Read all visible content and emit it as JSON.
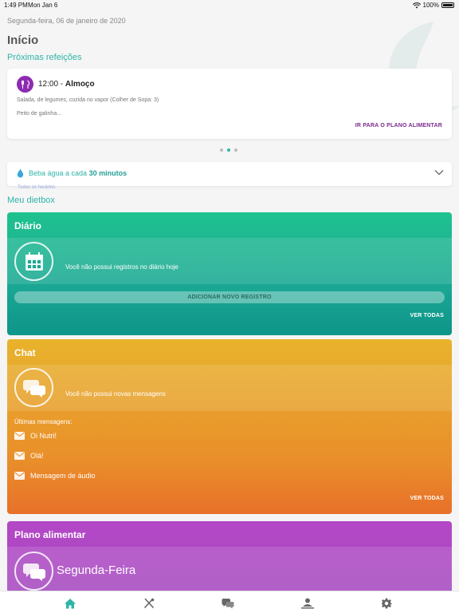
{
  "status_bar": {
    "time": "1:49 PM",
    "date": "Mon Jan 6",
    "battery": "100%"
  },
  "header": {
    "date": "Segunda-feira, 06 de janeiro de 2020",
    "title": "Início"
  },
  "next_meals": {
    "label": "Próximas refeições",
    "meal": {
      "time": "12:00",
      "separator": " - ",
      "name": "Almoço",
      "line1": "Salada, de legumes, cozida no vapor (Colher de Sopa: 3)",
      "line2": "Peito de galinha...",
      "link": "IR PARA O PLANO ALIMENTAR"
    },
    "pagination": {
      "count": 3,
      "active": 2
    }
  },
  "water": {
    "prefix": "Beba água a cada ",
    "interval": "30 minutos",
    "sub": "Todos os horários"
  },
  "dietbox": {
    "label": "Meu dietbox",
    "diario": {
      "title": "Diário",
      "message": "Você não possui registros no diário hoje",
      "button": "ADICIONAR NOVO REGISTRO",
      "link": "VER TODAS"
    },
    "chat": {
      "title": "Chat",
      "message": "Você não possui novas mensagens",
      "recent_label": "Últimas mensagens:",
      "messages": [
        "Oi Nutri!",
        "Olá!",
        "Mensagem de áudio"
      ],
      "link": "VER TODAS"
    },
    "plano": {
      "title": "Plano alimentar",
      "day": "Segunda-Feira"
    }
  },
  "tab_bar": {
    "tabs": [
      "home-icon",
      "utensils-icon",
      "chat-icon",
      "profile-icon",
      "gear-icon"
    ],
    "active": "home-icon"
  },
  "colors": {
    "accent": "#2eb5a8",
    "diario": "#1aa793",
    "chat": "#e8902a",
    "plano": "#b447c6",
    "meal_icon": "#8e2bb0"
  }
}
